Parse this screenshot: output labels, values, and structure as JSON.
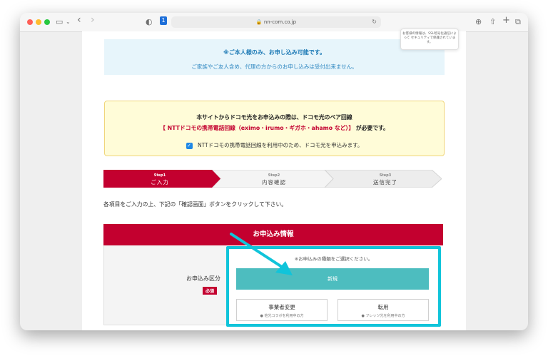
{
  "browser": {
    "url": "nn-com.co.jp",
    "tooltip_text": "お客様の情報は、SSL暗号化通信によって セキュリティで保護されています。"
  },
  "notice_blue": {
    "line1": "※ご本人様のみ、お申し込み可能です。",
    "line2": "ご家族やご友人含め、代理の方からのお申し込みは受付出来ません。"
  },
  "notice_yellow": {
    "line1": "本サイトからドコモ光をお申込みの際は、ドコモ光のペア回線",
    "line2_prefix": "【 NTTドコモの携帯電話回線（eximo・irumo・ギガホ・ahamo など）】",
    "line2_suffix": "が必要です。",
    "checkbox_label": "NTTドコモの携帯電話回線を利用中のため、ドコモ光を申込みます。",
    "checkbox_checked": true
  },
  "steps": [
    {
      "num": "Step1",
      "label": "ご入力",
      "active": true
    },
    {
      "num": "Step2",
      "label": "内容確認",
      "active": false
    },
    {
      "num": "Step3",
      "label": "送信完了",
      "active": false
    }
  ],
  "intro_text": "各項目をご入力の上、下記の「確認画面」ボタンをクリックして下さい。",
  "form": {
    "title": "お申込み情報",
    "row_label": "お申込み区分",
    "required_badge": "必須",
    "hint": "※お申込みの種類をご選択ください。",
    "option_new": "新規",
    "option_change": {
      "label": "事業者変更",
      "sub": "● 他光コラボを利用中の方"
    },
    "option_transfer": {
      "label": "転用",
      "sub": "● フレッツ光を利用中の方"
    }
  },
  "colors": {
    "brand_red": "#c3002f",
    "teal": "#4dbdbf",
    "highlight_cyan": "#10c4da"
  }
}
